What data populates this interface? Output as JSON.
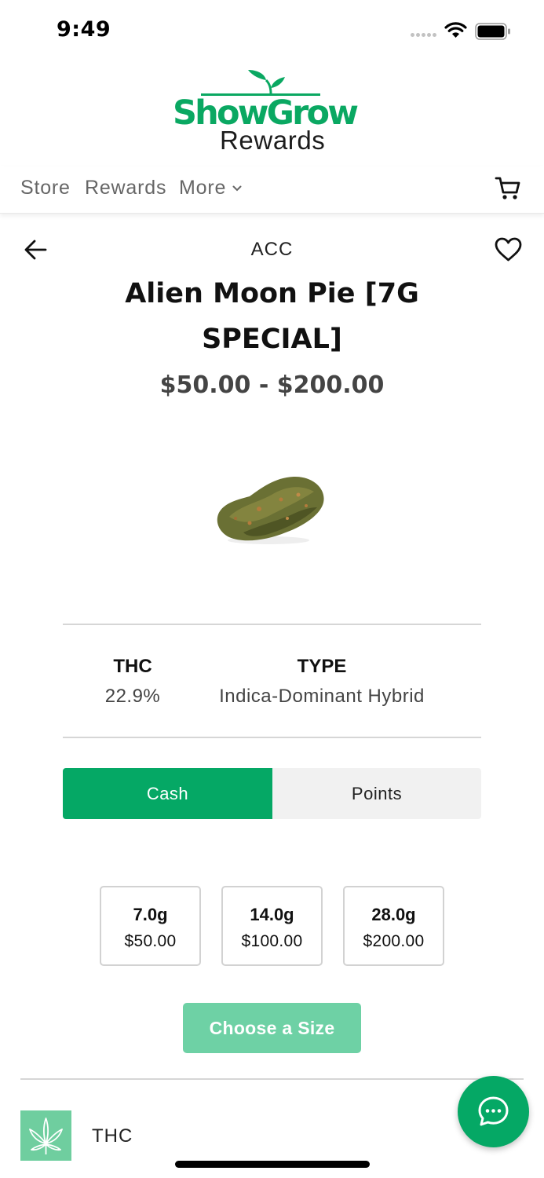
{
  "status_bar": {
    "time": "9:49"
  },
  "logo": {
    "word": "ShowGrow",
    "sub": "Rewards"
  },
  "nav": {
    "store": "Store",
    "rewards": "Rewards",
    "more": "More"
  },
  "product": {
    "brand": "ACC",
    "title": "Alien Moon Pie [7G SPECIAL]",
    "price_range": "$50.00 - $200.00"
  },
  "specs": {
    "thc_label": "THC",
    "thc_value": "22.9%",
    "type_label": "TYPE",
    "type_value": "Indica-Dominant Hybrid"
  },
  "payment": {
    "cash": "Cash",
    "points": "Points",
    "selected": "Cash"
  },
  "sizes": [
    {
      "weight": "7.0g",
      "price": "$50.00"
    },
    {
      "weight": "14.0g",
      "price": "$100.00"
    },
    {
      "weight": "28.0g",
      "price": "$200.00"
    }
  ],
  "choose_size_label": "Choose a Size",
  "section": {
    "label": "THC"
  },
  "colors": {
    "brand_green": "#0aa862",
    "button_green": "#05a865",
    "disabled_green": "#6ed1a5",
    "badge_green": "#6fce9f"
  },
  "icons": [
    "signal-icon",
    "wifi-icon",
    "battery-icon",
    "chevron-down-icon",
    "cart-icon",
    "back-arrow-icon",
    "heart-icon",
    "cannabis-leaf-icon",
    "chat-icon"
  ]
}
